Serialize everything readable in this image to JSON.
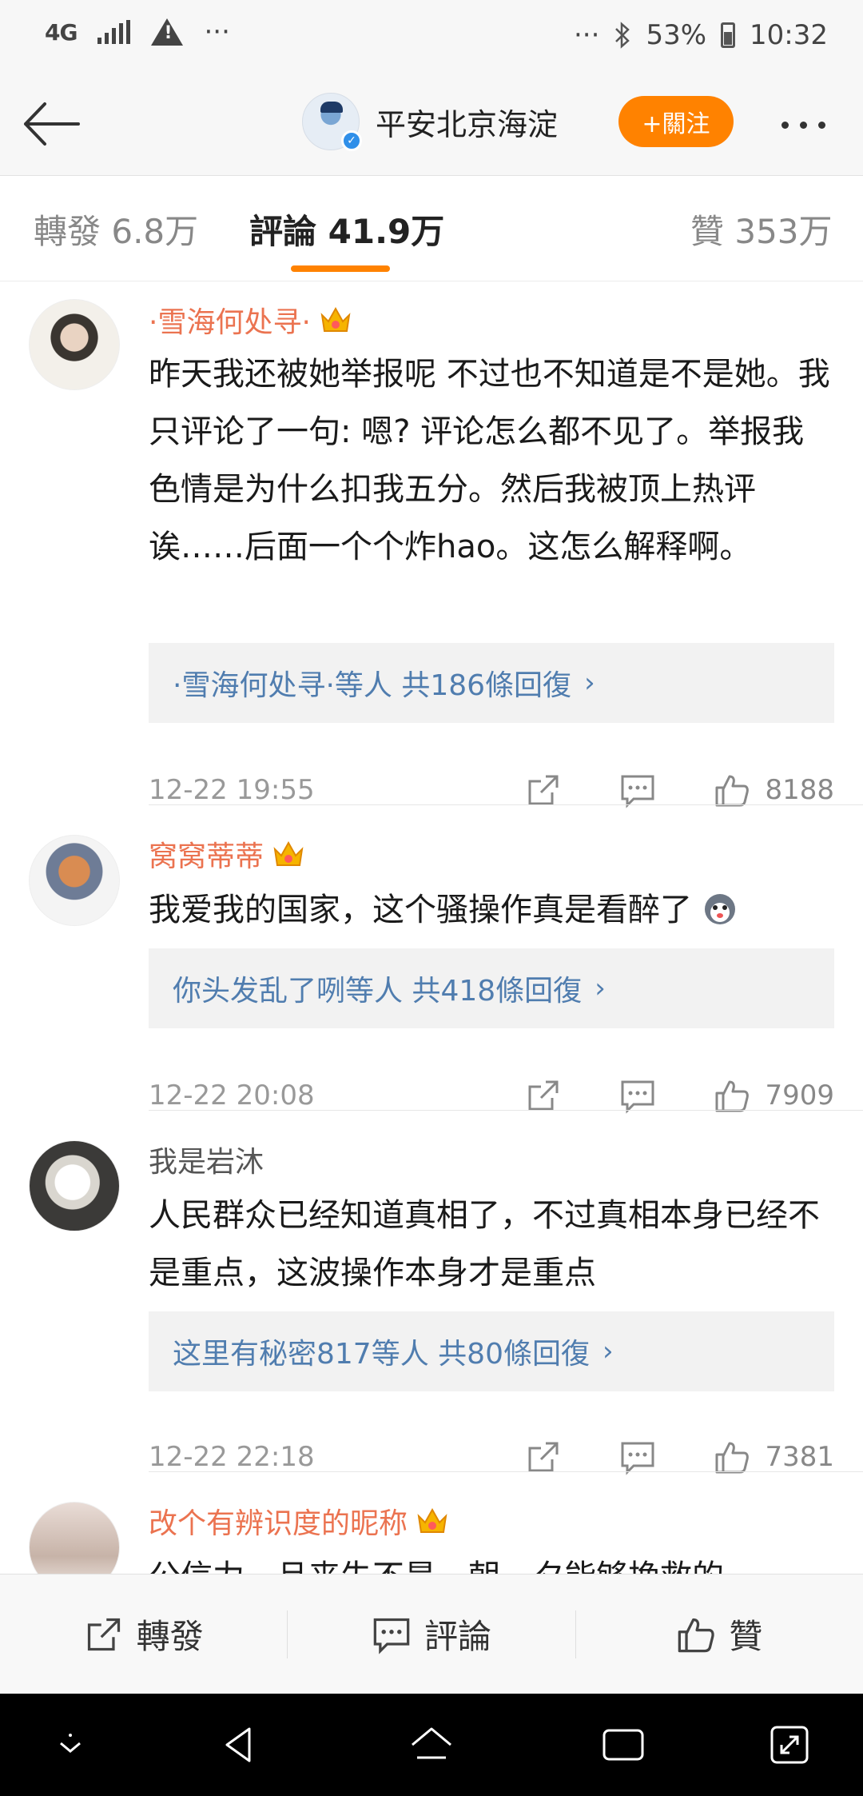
{
  "status_bar": {
    "network": "4G",
    "overflow": "···",
    "right_overflow": "···",
    "battery": "53%",
    "time": "10:32"
  },
  "header": {
    "account_name": "平安北京海淀",
    "follow_label": "+關注"
  },
  "tabs": [
    {
      "label": "轉發 6.8万"
    },
    {
      "label": "評論 41.9万"
    },
    {
      "label": "贊 353万"
    }
  ],
  "comments": [
    {
      "name": "·雪海何处寻·",
      "text": "昨天我还被她举报呢 不过也不知道是不是她。我只评论了一句: 嗯? 评论怎么都不见了。举报我色情是为什么扣我五分。然后我被顶上热评诶……后面一个个炸hao。这怎么解释啊。",
      "reply_user": "·雪海何处寻·",
      "reply_suffix": "等人 共186條回復",
      "time": "12-22 19:55",
      "likes": "8188"
    },
    {
      "name": "窝窝蒂蒂",
      "text": "我爱我的国家，这个骚操作真是看醉了",
      "reply_user": "你头发乱了咧",
      "reply_suffix": "等人 共418條回復",
      "time": "12-22 20:08",
      "likes": "7909"
    },
    {
      "name": "我是岩沐",
      "text": "人民群众已经知道真相了，不过真相本身已经不是重点，这波操作本身才是重点",
      "reply_user": "这里有秘密817",
      "reply_suffix": "等人 共80條回復",
      "time": "12-22 22:18",
      "likes": "7381"
    },
    {
      "name": "改个有辨识度的昵称",
      "text": "公信力一旦丧失不是一朝一夕能够挽救的"
    }
  ],
  "bottom_bar": {
    "repost": "轉發",
    "comment": "評論",
    "like": "贊"
  },
  "colors": {
    "accent": "#ff8200",
    "vip_name": "#eb7350",
    "link": "#507daf"
  }
}
